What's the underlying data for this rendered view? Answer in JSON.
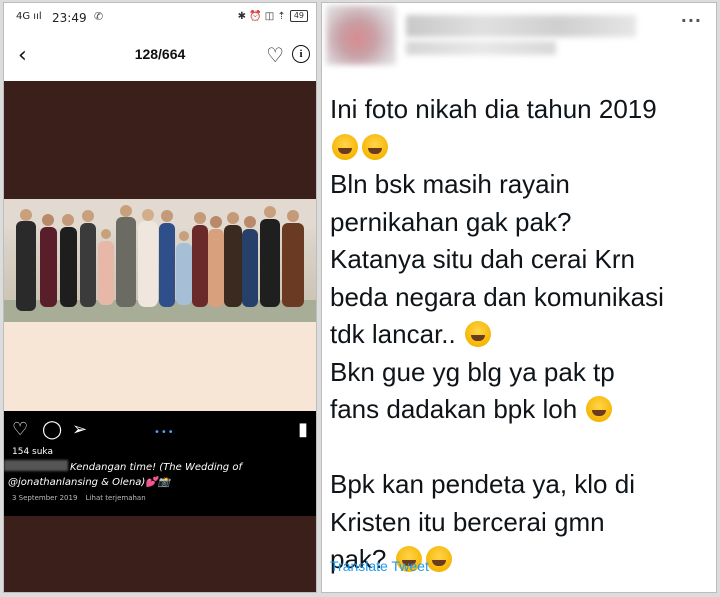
{
  "status_bar": {
    "signal": "4G ııl",
    "time": "23:49",
    "whatsapp_icon": "whatsapp-icon",
    "right_icons": "✱ ⏰ ◫ ⇡",
    "battery": "49"
  },
  "instagram": {
    "header": {
      "back_icon": "back-arrow-icon",
      "counter": "128/664"
    },
    "likes": "154 suka",
    "caption": "Kendangan time! (The Wedding of @jonathanlansing & Olena)💕📸",
    "date": "3 September 2019",
    "see_translation": "Lihat terjemahan",
    "colors": {
      "post_bg": "#3a1f1b",
      "mat": "#f7e6d6",
      "bar_bg": "#000000"
    }
  },
  "tweet": {
    "lines": [
      "Ini foto nikah dia tahun 2019",
      "Bln bsk masih rayain",
      "pernikahan gak pak?",
      "Katanya situ dah cerai Krn",
      "beda negara dan komunikasi",
      "tdk lancar..",
      "Bkn gue yg blg ya pak tp",
      "fans dadakan bpk loh",
      "Bpk kan pendeta ya, klo di",
      "Kristen itu bercerai gmn",
      "pak?"
    ],
    "translate": "Translate Tweet",
    "more": "···",
    "link_color": "#1d9bf0"
  }
}
